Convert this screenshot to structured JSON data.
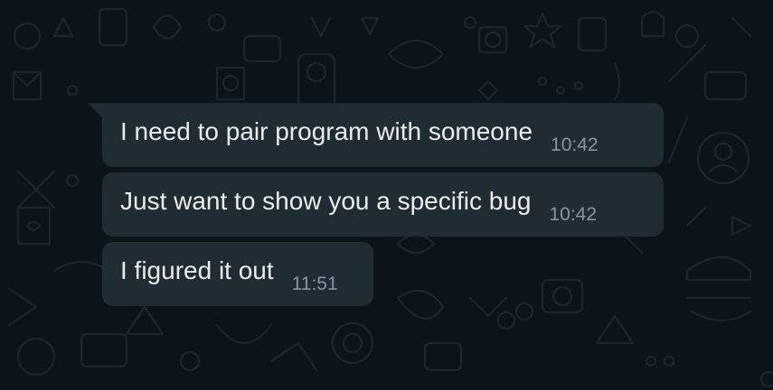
{
  "colors": {
    "background": "#0b141a",
    "bubble": "#202c33",
    "text": "#e9edef",
    "timestamp": "#8696a0",
    "wallpaper_doodle": "#1c262d"
  },
  "messages": [
    {
      "text": "I need to pair program with someone",
      "time": "10:42"
    },
    {
      "text": "Just want to show you a specific bug",
      "time": "10:42"
    },
    {
      "text": "I figured it out",
      "time": "11:51"
    }
  ]
}
